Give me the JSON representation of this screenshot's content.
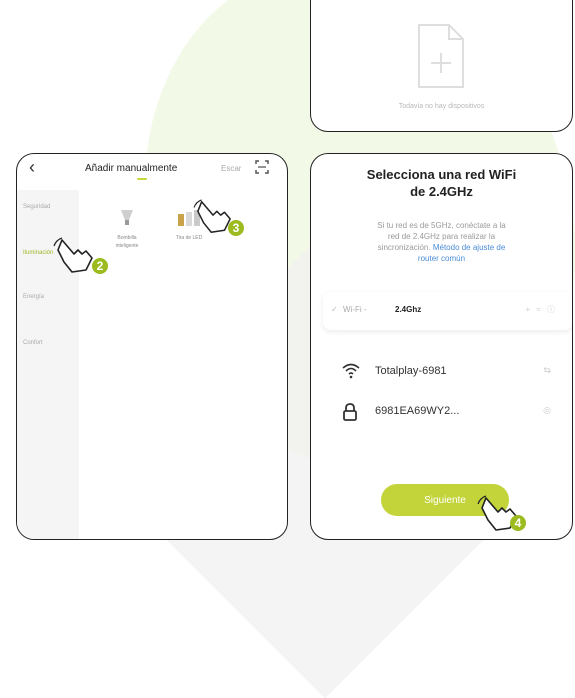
{
  "colors": {
    "accent": "#c2d43a",
    "badge": "#9cbb1f",
    "link": "#4a8bd6"
  },
  "top_phone": {
    "empty_text": "Todavía no hay dispositivos",
    "icon": "add-document-icon"
  },
  "left_phone": {
    "back_icon": "chevron-left-icon",
    "title": "Añadir manualmente",
    "scan_label": "Escar",
    "scan_icon": "scan-icon",
    "categories": [
      "Seguridad",
      "Iluminación",
      "Energía",
      "Confort"
    ],
    "devices": [
      {
        "label_line1": "Bombilla",
        "label_line2": "inteligente",
        "icon": "light-bulb-icon"
      },
      {
        "label_line1": "Tira de LED",
        "label_line2": "",
        "icon": "led-strip-icon"
      }
    ]
  },
  "right_phone": {
    "title_line1": "Selecciona una red WiFi",
    "title_line2": "de 2.4GHz",
    "desc_line1": "Si tu red es de 5GHz, conéctate a la",
    "desc_line2": "red de 2.4GHz para realizar la",
    "desc_line3_prefix": "sincronización.",
    "desc_link_1": "Método de ajuste de",
    "desc_link_2": "router común",
    "band_check": "✓",
    "band_label": "Wi-Fi -",
    "band_value": "2.4Ghz",
    "band_trailing": "+ ≈ ⓘ",
    "wifi_icon": "wifi-icon",
    "network_name": "Totalplay-6981",
    "network_trailing": "⇆",
    "lock_icon": "lock-icon",
    "password": "6981EA69WY2...",
    "password_trailing": "◎",
    "next_button": "Siguiente"
  },
  "steps": [
    "2",
    "3",
    "4"
  ]
}
